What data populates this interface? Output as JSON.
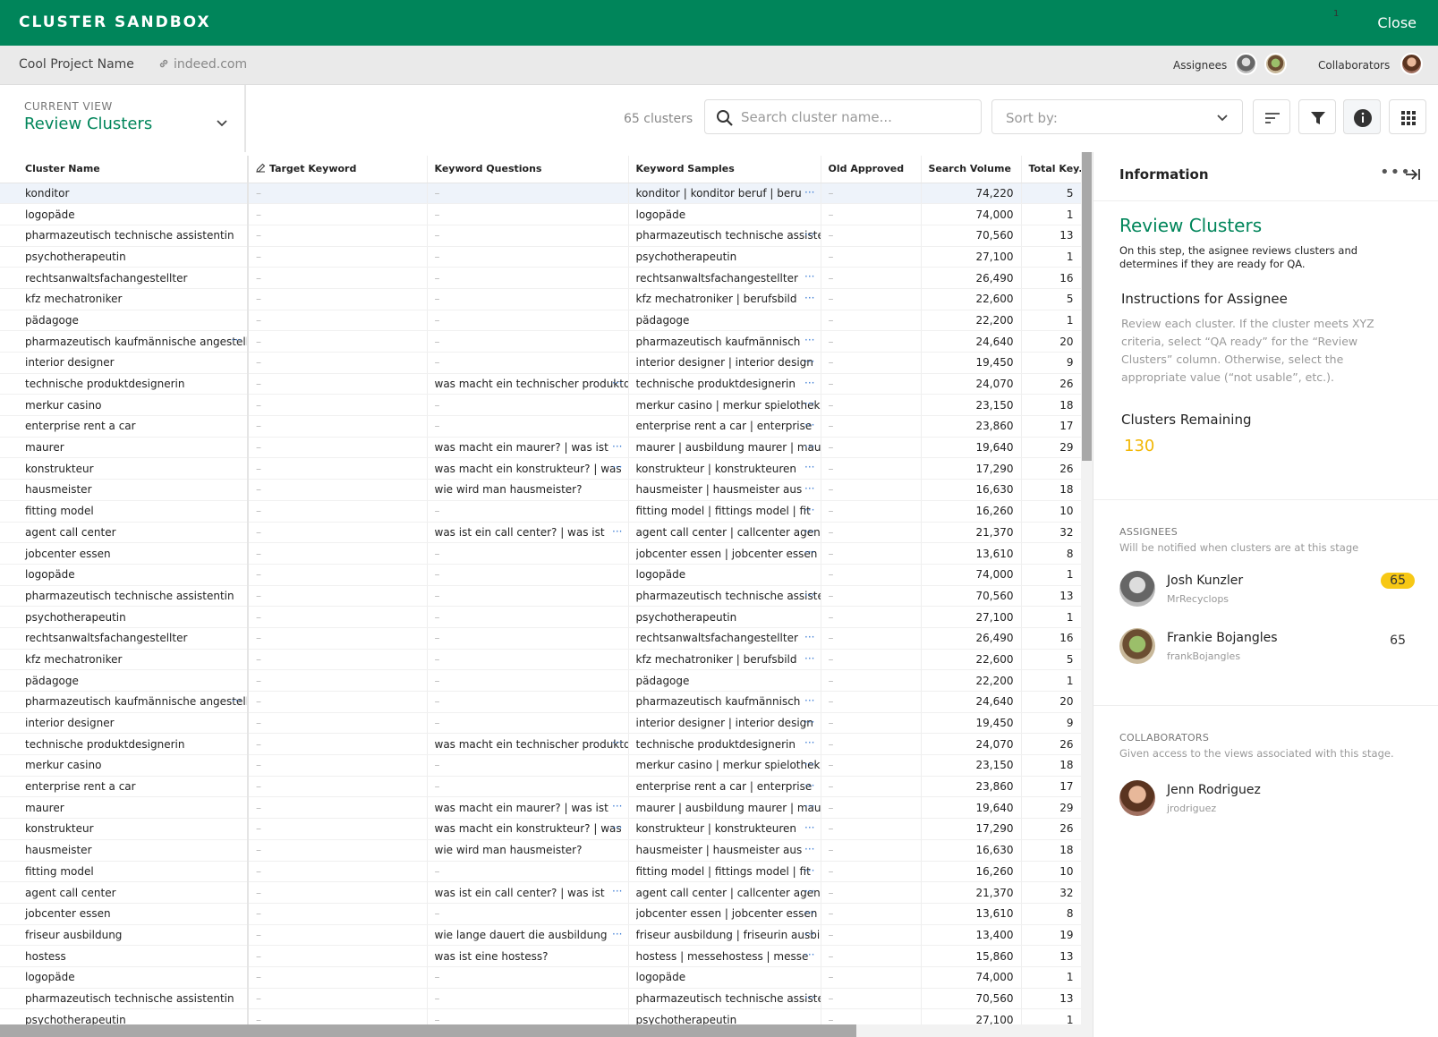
{
  "app": {
    "title": "CLUSTER SANDBOX",
    "close_label": "Close"
  },
  "project": {
    "name": "Cool Project Name",
    "link": "indeed.com",
    "assignees_label": "Assignees",
    "collaborators_label": "Collaborators"
  },
  "view": {
    "caption": "CURRENT VIEW",
    "name": "Review Clusters"
  },
  "toolbar": {
    "count": "65 clusters",
    "search_placeholder": "Search cluster name...",
    "sort_placeholder": "Sort by:",
    "filter_badge": "1"
  },
  "table": {
    "columns": [
      "Cluster Name",
      "Target Keyword",
      "Keyword Questions",
      "Keyword Samples",
      "Old Approved",
      "Search Volume",
      "Total Key..."
    ],
    "dash": "–",
    "rows": [
      [
        "konditor",
        "–",
        "–",
        "konditor | konditor beruf | beruf",
        "–",
        "74,220",
        "5"
      ],
      [
        "logopäde",
        "–",
        "–",
        "logopäde",
        "–",
        "74,000",
        "1"
      ],
      [
        "pharmazeutisch technische assistentin",
        "–",
        "–",
        "pharmazeutisch technische assistentin",
        "–",
        "70,560",
        "13"
      ],
      [
        "psychotherapeutin",
        "–",
        "–",
        "psychotherapeutin",
        "–",
        "27,100",
        "1"
      ],
      [
        "rechtsanwaltsfachangestellter",
        "–",
        "–",
        "rechtsanwaltsfachangestellter",
        "–",
        "26,490",
        "16"
      ],
      [
        "kfz mechatroniker",
        "–",
        "–",
        "kfz mechatroniker | berufsbild",
        "–",
        "22,600",
        "5"
      ],
      [
        "pädagoge",
        "–",
        "–",
        "pädagoge",
        "–",
        "22,200",
        "1"
      ],
      [
        "pharmazeutisch kaufmännische angestellte",
        "–",
        "–",
        "pharmazeutisch kaufmännisch",
        "–",
        "24,640",
        "20"
      ],
      [
        "interior designer",
        "–",
        "–",
        "interior designer | interior design",
        "–",
        "19,450",
        "9"
      ],
      [
        "technische produktdesignerin",
        "–",
        "was macht ein technischer produktdesigner",
        "technische produktdesignerin",
        "–",
        "24,070",
        "26"
      ],
      [
        "merkur casino",
        "–",
        "–",
        "merkur casino | merkur spielothek",
        "–",
        "23,150",
        "18"
      ],
      [
        "enterprise rent a car",
        "–",
        "–",
        "enterprise rent a car | enterprise",
        "–",
        "23,860",
        "17"
      ],
      [
        "maurer",
        "–",
        "was macht ein maurer? | was ist",
        "maurer | ausbildung maurer | maurer",
        "–",
        "19,640",
        "29"
      ],
      [
        "konstrukteur",
        "–",
        "was macht ein konstrukteur? | was",
        "konstrukteur | konstrukteuren",
        "–",
        "17,290",
        "26"
      ],
      [
        "hausmeister",
        "–",
        "wie wird man hausmeister?",
        "hausmeister | hausmeister aus",
        "–",
        "16,630",
        "18"
      ],
      [
        "fitting model",
        "–",
        "–",
        "fitting model | fittings model | fit",
        "–",
        "16,260",
        "10"
      ],
      [
        "agent call center",
        "–",
        "was ist ein call center? | was ist",
        "agent call center | callcenter agent",
        "–",
        "21,370",
        "32"
      ],
      [
        "jobcenter essen",
        "–",
        "–",
        "jobcenter essen | jobcenter essen",
        "–",
        "13,610",
        "8"
      ],
      [
        "logopäde",
        "–",
        "–",
        "logopäde",
        "–",
        "74,000",
        "1"
      ],
      [
        "pharmazeutisch technische assistentin",
        "–",
        "–",
        "pharmazeutisch technische assistentin",
        "–",
        "70,560",
        "13"
      ],
      [
        "psychotherapeutin",
        "–",
        "–",
        "psychotherapeutin",
        "–",
        "27,100",
        "1"
      ],
      [
        "rechtsanwaltsfachangestellter",
        "–",
        "–",
        "rechtsanwaltsfachangestellter",
        "–",
        "26,490",
        "16"
      ],
      [
        "kfz mechatroniker",
        "–",
        "–",
        "kfz mechatroniker | berufsbild",
        "–",
        "22,600",
        "5"
      ],
      [
        "pädagoge",
        "–",
        "–",
        "pädagoge",
        "–",
        "22,200",
        "1"
      ],
      [
        "pharmazeutisch kaufmännische angestellte",
        "–",
        "–",
        "pharmazeutisch kaufmännisch",
        "–",
        "24,640",
        "20"
      ],
      [
        "interior designer",
        "–",
        "–",
        "interior designer | interior design",
        "–",
        "19,450",
        "9"
      ],
      [
        "technische produktdesignerin",
        "–",
        "was macht ein technischer produktdesigner",
        "technische produktdesignerin",
        "–",
        "24,070",
        "26"
      ],
      [
        "merkur casino",
        "–",
        "–",
        "merkur casino | merkur spielothek",
        "–",
        "23,150",
        "18"
      ],
      [
        "enterprise rent a car",
        "–",
        "–",
        "enterprise rent a car | enterprise",
        "–",
        "23,860",
        "17"
      ],
      [
        "maurer",
        "–",
        "was macht ein maurer? | was ist",
        "maurer | ausbildung maurer | maurer",
        "–",
        "19,640",
        "29"
      ],
      [
        "konstrukteur",
        "–",
        "was macht ein konstrukteur? | was",
        "konstrukteur | konstrukteuren",
        "–",
        "17,290",
        "26"
      ],
      [
        "hausmeister",
        "–",
        "wie wird man hausmeister?",
        "hausmeister | hausmeister aus",
        "–",
        "16,630",
        "18"
      ],
      [
        "fitting model",
        "–",
        "–",
        "fitting model | fittings model | fit",
        "–",
        "16,260",
        "10"
      ],
      [
        "agent call center",
        "–",
        "was ist ein call center? | was ist",
        "agent call center | callcenter agent",
        "–",
        "21,370",
        "32"
      ],
      [
        "jobcenter essen",
        "–",
        "–",
        "jobcenter essen | jobcenter essen",
        "–",
        "13,610",
        "8"
      ],
      [
        "friseur ausbildung",
        "–",
        "wie lange dauert die ausbildung",
        "friseur ausbildung | friseurin ausbildung",
        "–",
        "13,400",
        "19"
      ],
      [
        "hostess",
        "–",
        "was ist eine hostess?",
        "hostess | messehostess | messe",
        "–",
        "15,860",
        "13"
      ],
      [
        "logopäde",
        "–",
        "–",
        "logopäde",
        "–",
        "74,000",
        "1"
      ],
      [
        "pharmazeutisch technische assistentin",
        "–",
        "–",
        "pharmazeutisch technische assistentin",
        "–",
        "70,560",
        "13"
      ],
      [
        "psychotherapeutin",
        "–",
        "–",
        "psychotherapeutin",
        "–",
        "27,100",
        "1"
      ]
    ],
    "more_cells": [
      [
        0,
        3
      ],
      [
        2,
        3
      ],
      [
        4,
        3
      ],
      [
        5,
        3
      ],
      [
        7,
        0
      ],
      [
        7,
        3
      ],
      [
        8,
        3
      ],
      [
        9,
        2
      ],
      [
        9,
        3
      ],
      [
        10,
        3
      ],
      [
        11,
        3
      ],
      [
        12,
        2
      ],
      [
        12,
        3
      ],
      [
        13,
        2
      ],
      [
        13,
        3
      ],
      [
        14,
        3
      ],
      [
        15,
        3
      ],
      [
        16,
        2
      ],
      [
        16,
        3
      ],
      [
        17,
        3
      ],
      [
        19,
        3
      ],
      [
        21,
        3
      ],
      [
        22,
        3
      ],
      [
        24,
        0
      ],
      [
        24,
        3
      ],
      [
        25,
        3
      ],
      [
        26,
        2
      ],
      [
        26,
        3
      ],
      [
        27,
        3
      ],
      [
        28,
        3
      ],
      [
        29,
        2
      ],
      [
        29,
        3
      ],
      [
        30,
        2
      ],
      [
        30,
        3
      ],
      [
        31,
        3
      ],
      [
        32,
        3
      ],
      [
        33,
        2
      ],
      [
        33,
        3
      ],
      [
        34,
        3
      ],
      [
        35,
        2
      ],
      [
        35,
        3
      ],
      [
        36,
        3
      ],
      [
        38,
        3
      ]
    ],
    "more_glyph": "···"
  },
  "info": {
    "header": "Information",
    "title": "Review Clusters",
    "description": "On this step, the asignee reviews clusters and determines if they are ready for QA.",
    "instructions_label": "Instructions for Assignee",
    "instructions": "Review each cluster. If the cluster meets XYZ criteria, select “QA ready” for the “Review Clusters” column. Otherwise, select the appropriate value (“not usable”, etc.).",
    "remaining_label": "Clusters Remaining",
    "remaining_value": "130",
    "assignees_caption": "ASSIGNEES",
    "assignees_sub": "Will be notified when clusters are at this stage",
    "assignees": [
      {
        "name": "Josh Kunzler",
        "user": "MrRecyclops",
        "count": "65"
      },
      {
        "name": "Frankie Bojangles",
        "user": "frankBojangles",
        "count": "65"
      }
    ],
    "collaborators_caption": "COLLABORATORS",
    "collaborators_sub": "Given access to the views associated with this stage.",
    "collaborators": [
      {
        "name": "Jenn Rodriguez",
        "user": "jrodriguez"
      }
    ]
  }
}
